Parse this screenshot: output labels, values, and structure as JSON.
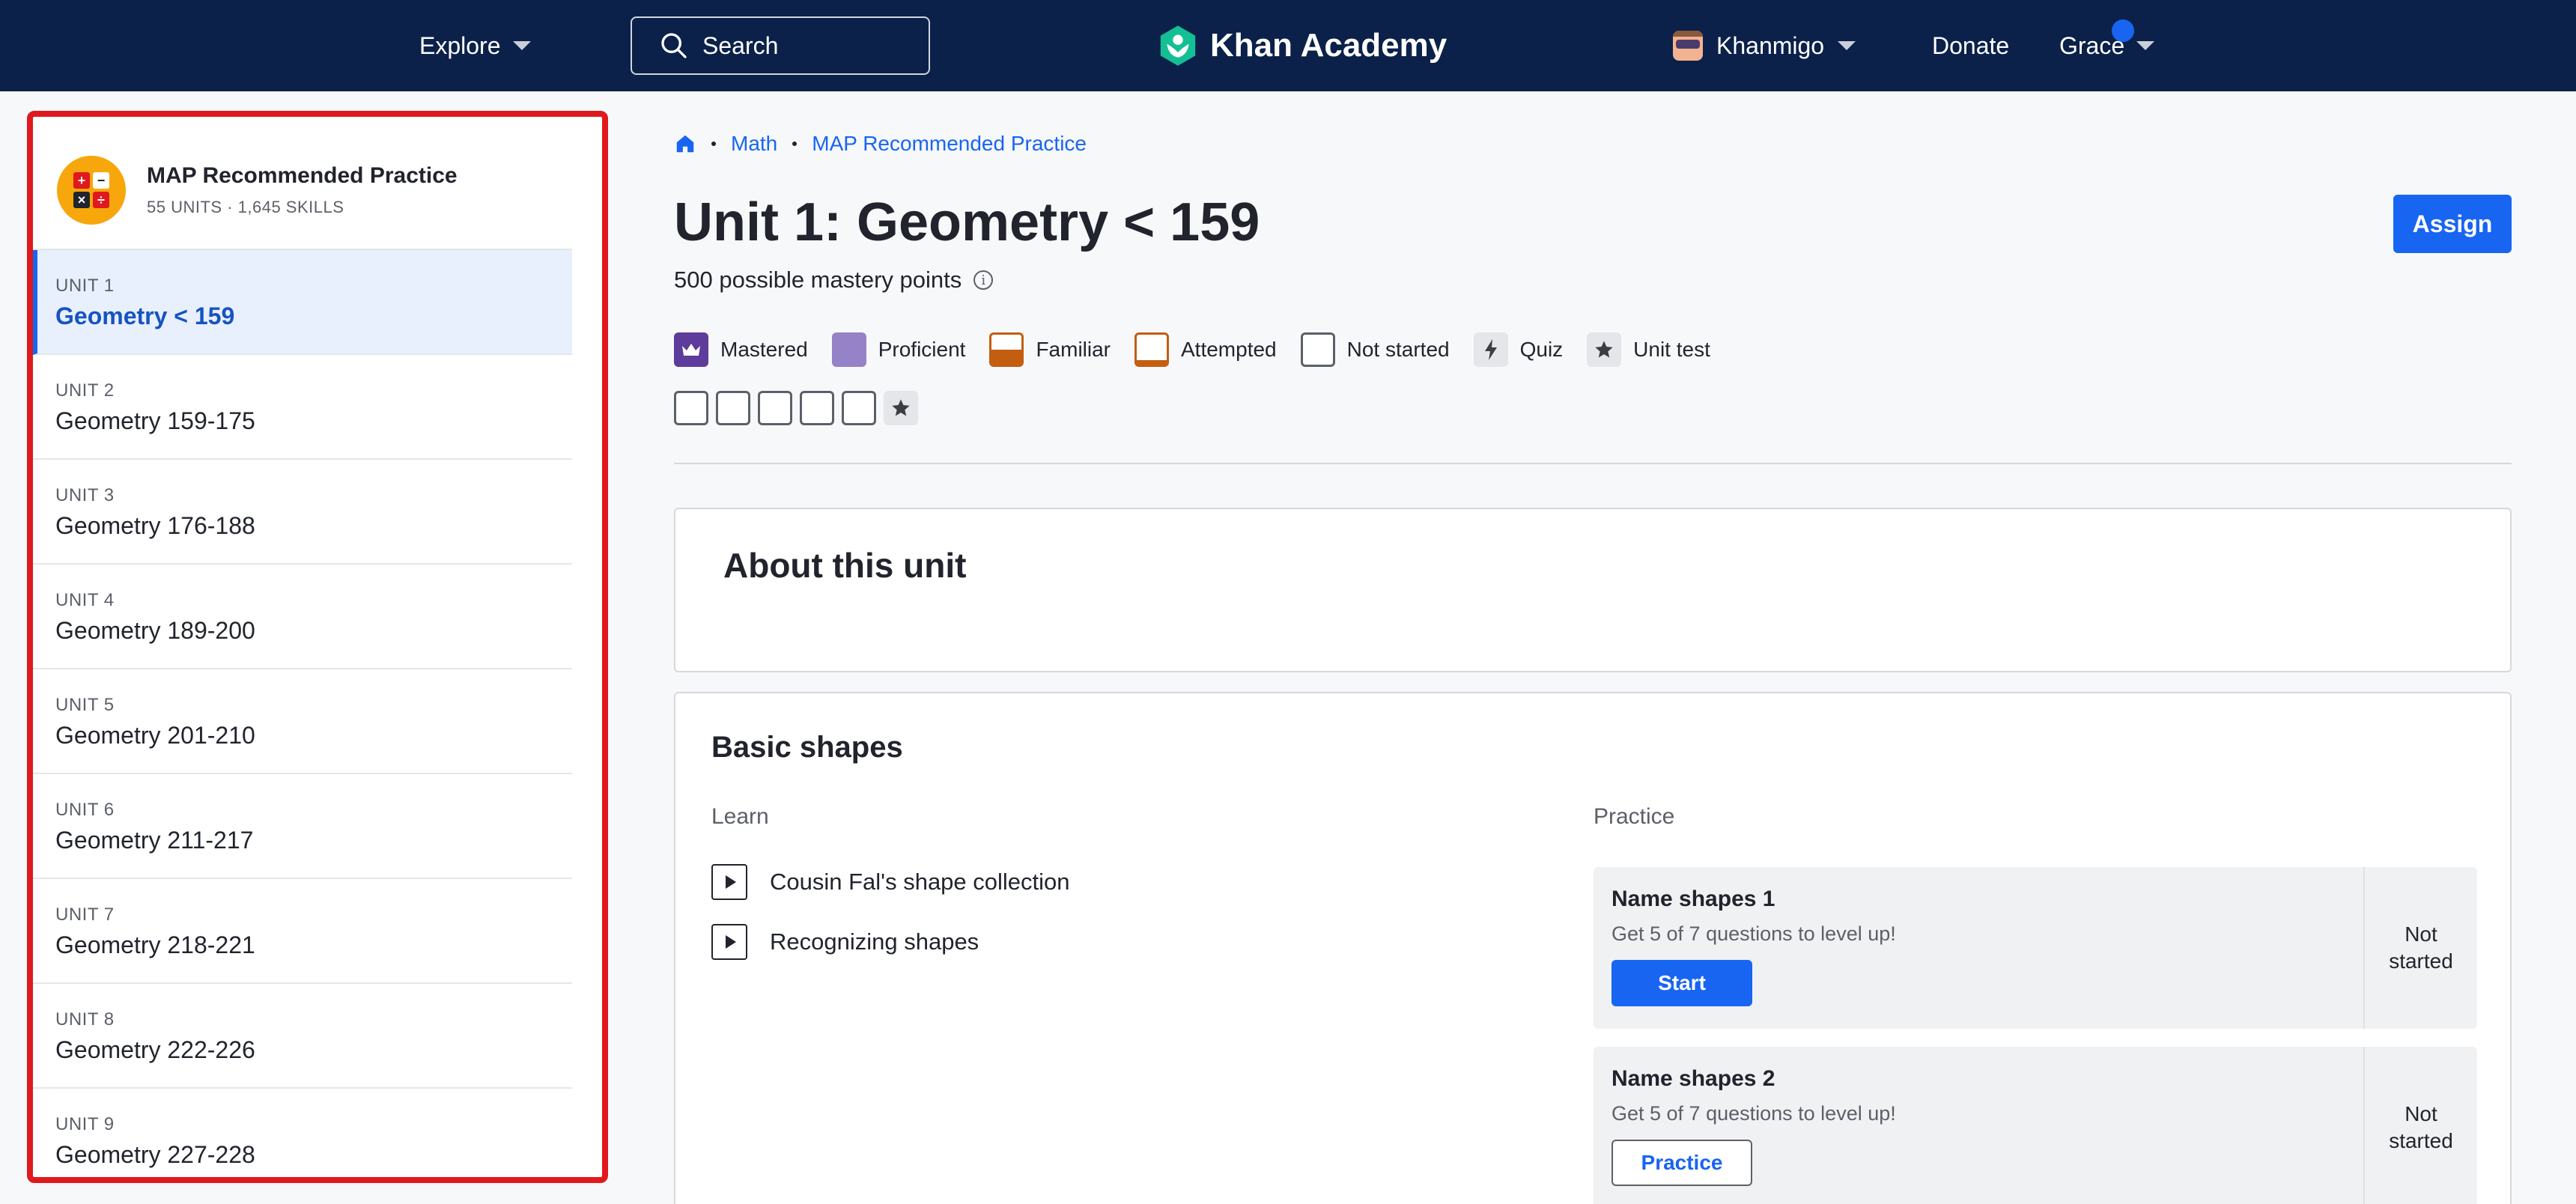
{
  "nav": {
    "explore_label": "Explore",
    "search_placeholder": "Search",
    "logo_text": "Khan Academy",
    "khanmigo_label": "Khanmigo",
    "donate_label": "Donate",
    "user_name": "Grace",
    "colors": {
      "bar": "#0b2149",
      "logo_leaf": "#14bf96",
      "notification": "#1865f2"
    }
  },
  "sidebar": {
    "course_title": "MAP Recommended Practice",
    "course_meta": "55 UNITS · 1,645 SKILLS",
    "course_icon_glyphs": [
      "+",
      "−",
      "×",
      "÷"
    ],
    "units": [
      {
        "num": "UNIT 1",
        "title": "Geometry < 159",
        "active": true
      },
      {
        "num": "UNIT 2",
        "title": "Geometry 159-175"
      },
      {
        "num": "UNIT 3",
        "title": "Geometry 176-188"
      },
      {
        "num": "UNIT 4",
        "title": "Geometry 189-200"
      },
      {
        "num": "UNIT 5",
        "title": "Geometry 201-210"
      },
      {
        "num": "UNIT 6",
        "title": "Geometry 211-217"
      },
      {
        "num": "UNIT 7",
        "title": "Geometry 218-221"
      },
      {
        "num": "UNIT 8",
        "title": "Geometry 222-226"
      },
      {
        "num": "UNIT 9",
        "title": "Geometry 227-228"
      }
    ]
  },
  "breadcrumb": {
    "home_icon": "home-icon",
    "items": [
      "Math",
      "MAP Recommended Practice"
    ]
  },
  "header": {
    "title": "Unit 1: Geometry < 159",
    "mastery_points": "500 possible mastery points",
    "assign_label": "Assign"
  },
  "legend": {
    "items": [
      {
        "label": "Mastered",
        "icon": "mastered-icon"
      },
      {
        "label": "Proficient",
        "icon": "proficient-icon"
      },
      {
        "label": "Familiar",
        "icon": "familiar-icon"
      },
      {
        "label": "Attempted",
        "icon": "attempted-icon"
      },
      {
        "label": "Not started",
        "icon": "not-started-icon"
      },
      {
        "label": "Quiz",
        "icon": "quiz-icon"
      },
      {
        "label": "Unit test",
        "icon": "unit-test-icon"
      }
    ]
  },
  "progress": {
    "skill_boxes": 5,
    "has_unit_test": true
  },
  "about": {
    "title": "About this unit"
  },
  "lesson": {
    "title": "Basic shapes",
    "learn_label": "Learn",
    "practice_label": "Practice",
    "videos": [
      "Cousin Fal's shape collection",
      "Recognizing shapes"
    ],
    "practices": [
      {
        "title": "Name shapes 1",
        "subtitle": "Get 5 of 7 questions to level up!",
        "button": "Start",
        "status": "Not started"
      },
      {
        "title": "Name shapes 2",
        "subtitle": "Get 5 of 7 questions to level up!",
        "button": "Practice",
        "status": "Not started"
      }
    ]
  }
}
